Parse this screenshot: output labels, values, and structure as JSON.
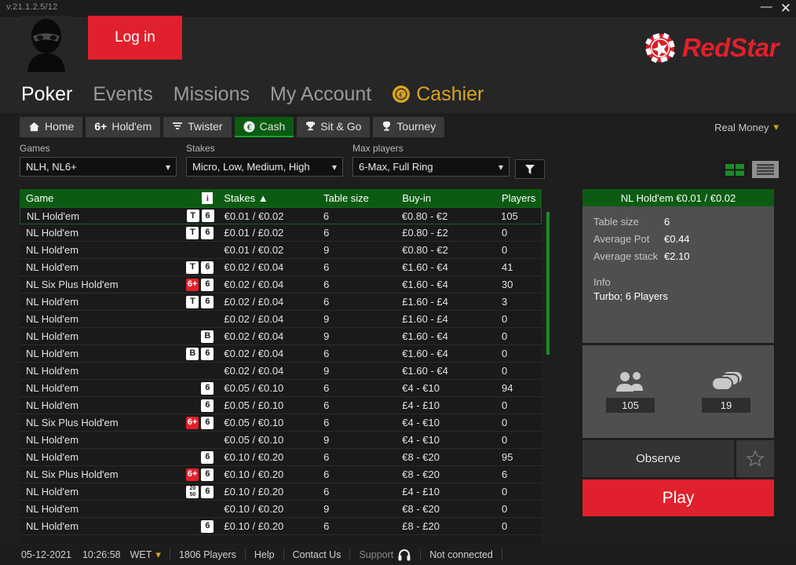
{
  "titlebar": {
    "version": "v.21.1.2.5/12",
    "minimize": "—",
    "close": "✕"
  },
  "header": {
    "login_label": "Log in",
    "brand": "RedStar"
  },
  "mainnav": [
    {
      "label": "Poker",
      "active": true
    },
    {
      "label": "Events",
      "active": false
    },
    {
      "label": "Missions",
      "active": false
    },
    {
      "label": "My Account",
      "active": false
    },
    {
      "label": "Cashier",
      "active": false
    }
  ],
  "tabs": [
    {
      "label": "Home",
      "icon": "home-icon",
      "active": false
    },
    {
      "label": "Hold'em",
      "icon": "six-plus-icon",
      "active": false
    },
    {
      "label": "Twister",
      "icon": "twister-icon",
      "active": false
    },
    {
      "label": "Cash",
      "icon": "euro-coin-icon",
      "active": true
    },
    {
      "label": "Sit & Go",
      "icon": "trophy-icon",
      "active": false
    },
    {
      "label": "Tourney",
      "icon": "cup-icon",
      "active": false
    }
  ],
  "money_mode": {
    "label": "Real Money"
  },
  "filters": {
    "games": {
      "label": "Games",
      "value": "NLH, NL6+"
    },
    "stakes": {
      "label": "Stakes",
      "value": "Micro, Low, Medium, High"
    },
    "max_players": {
      "label": "Max players",
      "value": "6-Max, Full Ring"
    }
  },
  "table": {
    "columns": [
      "Game",
      "Stakes ▲",
      "Table size",
      "Buy-in",
      "Players"
    ],
    "rows": [
      {
        "game": "NL Hold'em",
        "badges": [
          {
            "t": "T",
            "r": false
          },
          {
            "t": "6",
            "r": false
          }
        ],
        "stakes": "€0.01 / €0.02",
        "size": "6",
        "buyin": "€0.80 - €2",
        "players": "105",
        "selected": true
      },
      {
        "game": "NL Hold'em",
        "badges": [
          {
            "t": "T",
            "r": false
          },
          {
            "t": "6",
            "r": false
          }
        ],
        "stakes": "£0.01 / £0.02",
        "size": "6",
        "buyin": "£0.80 - £2",
        "players": "0"
      },
      {
        "game": "NL Hold'em",
        "badges": [],
        "stakes": "€0.01 / €0.02",
        "size": "9",
        "buyin": "€0.80 - €2",
        "players": "0"
      },
      {
        "game": "NL Hold'em",
        "badges": [
          {
            "t": "T",
            "r": false
          },
          {
            "t": "6",
            "r": false
          }
        ],
        "stakes": "€0.02 / €0.04",
        "size": "6",
        "buyin": "€1.60 - €4",
        "players": "41"
      },
      {
        "game": "NL Six Plus Hold'em",
        "badges": [
          {
            "t": "6+",
            "r": true
          },
          {
            "t": "6",
            "r": false
          }
        ],
        "stakes": "€0.02 / €0.04",
        "size": "6",
        "buyin": "€1.60 - €4",
        "players": "30"
      },
      {
        "game": "NL Hold'em",
        "badges": [
          {
            "t": "T",
            "r": false
          },
          {
            "t": "6",
            "r": false
          }
        ],
        "stakes": "£0.02 / £0.04",
        "size": "6",
        "buyin": "£1.60 - £4",
        "players": "3"
      },
      {
        "game": "NL Hold'em",
        "badges": [],
        "stakes": "£0.02 / £0.04",
        "size": "9",
        "buyin": "£1.60 - £4",
        "players": "0"
      },
      {
        "game": "NL Hold'em",
        "badges": [
          {
            "t": "B",
            "r": false
          }
        ],
        "stakes": "€0.02 / €0.04",
        "size": "9",
        "buyin": "€1.60 - €4",
        "players": "0"
      },
      {
        "game": "NL Hold'em",
        "badges": [
          {
            "t": "B",
            "r": false
          },
          {
            "t": "6",
            "r": false
          }
        ],
        "stakes": "€0.02 / €0.04",
        "size": "6",
        "buyin": "€1.60 - €4",
        "players": "0"
      },
      {
        "game": "NL Hold'em",
        "badges": [],
        "stakes": "€0.02 / €0.04",
        "size": "9",
        "buyin": "€1.60 - €4",
        "players": "0"
      },
      {
        "game": "NL Hold'em",
        "badges": [
          {
            "t": "6",
            "r": false
          }
        ],
        "stakes": "€0.05 / €0.10",
        "size": "6",
        "buyin": "€4 - €10",
        "players": "94"
      },
      {
        "game": "NL Hold'em",
        "badges": [
          {
            "t": "6",
            "r": false
          }
        ],
        "stakes": "£0.05 / £0.10",
        "size": "6",
        "buyin": "£4 - £10",
        "players": "0"
      },
      {
        "game": "NL Six Plus Hold'em",
        "badges": [
          {
            "t": "6+",
            "r": true
          },
          {
            "t": "6",
            "r": false
          }
        ],
        "stakes": "€0.05 / €0.10",
        "size": "6",
        "buyin": "€4 - €10",
        "players": "0"
      },
      {
        "game": "NL Hold'em",
        "badges": [],
        "stakes": "€0.05 / €0.10",
        "size": "9",
        "buyin": "€4 - €10",
        "players": "0"
      },
      {
        "game": "NL Hold'em",
        "badges": [
          {
            "t": "6",
            "r": false
          }
        ],
        "stakes": "€0.10 / €0.20",
        "size": "6",
        "buyin": "€8 - €20",
        "players": "95"
      },
      {
        "game": "NL Six Plus Hold'em",
        "badges": [
          {
            "t": "6+",
            "r": true
          },
          {
            "t": "6",
            "r": false
          }
        ],
        "stakes": "€0.10 / €0.20",
        "size": "6",
        "buyin": "€8 - €20",
        "players": "6"
      },
      {
        "game": "NL Hold'em",
        "badges": [
          {
            "t": "20/50",
            "r": false,
            "two": true
          },
          {
            "t": "6",
            "r": false
          }
        ],
        "stakes": "£0.10 / £0.20",
        "size": "6",
        "buyin": "£4 - £10",
        "players": "0"
      },
      {
        "game": "NL Hold'em",
        "badges": [],
        "stakes": "€0.10 / €0.20",
        "size": "9",
        "buyin": "€8 - €20",
        "players": "0"
      },
      {
        "game": "NL Hold'em",
        "badges": [
          {
            "t": "6",
            "r": false
          }
        ],
        "stakes": "£0.10 / £0.20",
        "size": "6",
        "buyin": "£8 - £20",
        "players": "0"
      }
    ]
  },
  "detail": {
    "title": "NL Hold'em €0.01 / €0.02",
    "stats": [
      {
        "key": "Table size",
        "value": "6"
      },
      {
        "key": "Average Pot",
        "value": "€0.44"
      },
      {
        "key": "Average stack",
        "value": "€2.10"
      }
    ],
    "info_label": "Info",
    "info_value": "Turbo; 6 Players",
    "counters": [
      {
        "icon": "players-icon",
        "value": "105"
      },
      {
        "icon": "tables-icon",
        "value": "19"
      }
    ],
    "observe_label": "Observe",
    "play_label": "Play"
  },
  "statusbar": {
    "date": "05-12-2021",
    "time": "10:26:58",
    "timezone": "WET",
    "players": "1806 Players",
    "help": "Help",
    "contact": "Contact Us",
    "support": "Support",
    "connection": "Not connected"
  }
}
